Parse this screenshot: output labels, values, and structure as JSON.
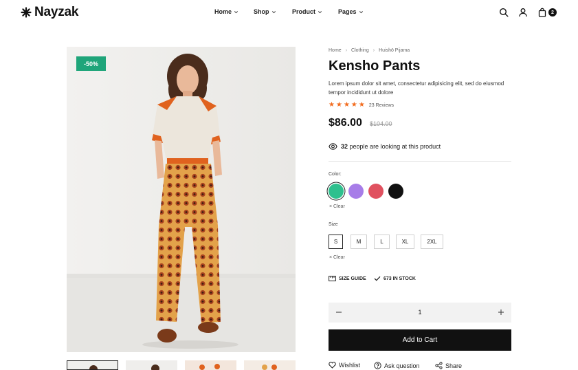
{
  "brand": {
    "name": "Nayzak"
  },
  "nav": {
    "items": [
      {
        "label": "Home"
      },
      {
        "label": "Shop"
      },
      {
        "label": "Product"
      },
      {
        "label": "Pages"
      }
    ]
  },
  "header": {
    "icons": [
      "search-icon",
      "user-icon",
      "bag-icon"
    ],
    "cart_count": "2"
  },
  "gallery": {
    "discount_badge": "-50%",
    "badge_color": "#1fa57a",
    "thumbnail_count": 4
  },
  "breadcrumb": [
    "Home",
    "Clothing",
    "Huishō Pijama"
  ],
  "product": {
    "title": "Kensho Pants",
    "description": "Lorem ipsum dolor sit amet, consectetur adipisicing elit, sed do eiusmod tempor incididunt ut dolore",
    "rating": 5,
    "reviews": "23 Reviews",
    "price": "$86.00",
    "old_price": "$104.00",
    "viewers_count": "32",
    "viewers_text": "people are looking at this product"
  },
  "color_option": {
    "label": "Color:",
    "swatches": [
      {
        "name": "green",
        "hex": "#2fc08e",
        "selected": true
      },
      {
        "name": "purple",
        "hex": "#a77de8"
      },
      {
        "name": "red",
        "hex": "#e0515f"
      },
      {
        "name": "black",
        "hex": "#111111"
      }
    ],
    "clear": "Clear"
  },
  "size_option": {
    "label": "Size",
    "sizes": [
      "S",
      "M",
      "L",
      "XL",
      "2XL"
    ],
    "selected": "S",
    "clear": "Clear"
  },
  "meta": {
    "size_guide": "SIZE GUIDE",
    "stock": "673 IN STOCK"
  },
  "purchase": {
    "quantity": "1",
    "add_to_cart": "Add to Cart"
  },
  "actions": {
    "wishlist": "Wishlist",
    "ask": "Ask question",
    "share": "Share"
  }
}
